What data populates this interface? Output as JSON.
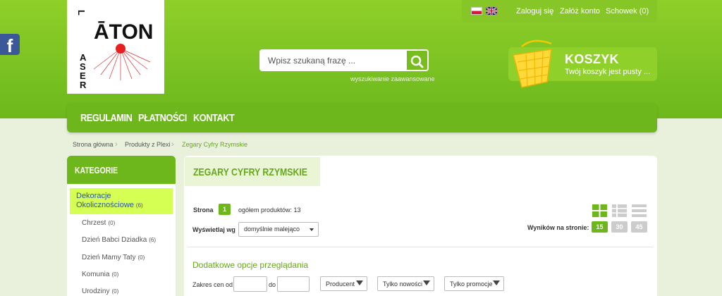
{
  "header": {
    "logo_text": "ATON LASER",
    "top_links": [
      "Zaloguj się",
      "Załóż konto",
      "Schowek (0)"
    ],
    "search": {
      "placeholder": "Wpisz szukaną frazę ...",
      "advanced_link": "wyszukiwanie zaawansowane"
    },
    "cart": {
      "title": "KOSZYK",
      "subtitle": "Twój koszyk jest pusty ..."
    }
  },
  "nav": {
    "items": [
      "REGULAMIN",
      "PŁATNOŚCI",
      "KONTAKT"
    ]
  },
  "breadcrumb": [
    "Strona główna",
    "Produkty z Plexi",
    "Zegary Cyfry Rzymskie"
  ],
  "sidebar": {
    "title": "KATEGORIE",
    "active": {
      "label": "Dekoracje Okolicznościowe",
      "count": "(6)"
    },
    "items": [
      {
        "label": "Chrzest",
        "count": "(0)"
      },
      {
        "label": "Dzień Babci Dziadka",
        "count": "(6)"
      },
      {
        "label": "Dzień Mamy Taty",
        "count": "(0)"
      },
      {
        "label": "Komunia",
        "count": "(0)"
      },
      {
        "label": "Urodziny",
        "count": "(0)"
      }
    ]
  },
  "main": {
    "title": "ZEGARY CYFRY RZYMSKIE",
    "page_label": "Strona",
    "page_number": "1",
    "total_products": "ogółem produktów: 13",
    "sort_label": "Wyświetlaj wg",
    "sort_value": "domyślnie malejąco",
    "per_page_label": "Wyników na stronie:",
    "per_page_options": [
      "15",
      "30",
      "45"
    ],
    "extra_title": "Dodatkowe opcje przeglądania",
    "price_range_label": "Zakres cen od",
    "price_to_label": "do",
    "filters": [
      "Producent",
      "Tylko nowości",
      "Tylko promocje"
    ]
  },
  "colors": {
    "primary_green": "#6db71c",
    "active_category": "#d6ff54",
    "title_green": "#65a81a"
  }
}
